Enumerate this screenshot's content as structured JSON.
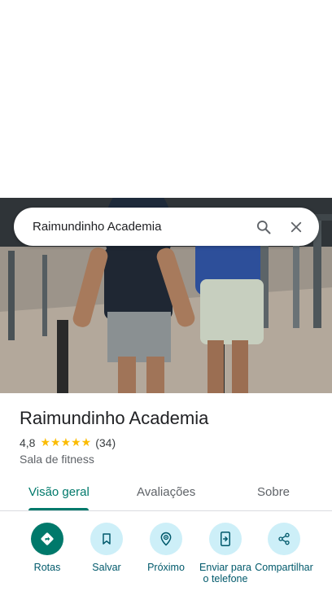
{
  "search": {
    "query": "Raimundinho Academia"
  },
  "place": {
    "name": "Raimundinho Academia",
    "rating": "4,8",
    "stars": "★★★★★",
    "review_count": "(34)",
    "category": "Sala de fitness"
  },
  "tabs": [
    {
      "label": "Visão geral",
      "active": true
    },
    {
      "label": "Avaliações",
      "active": false
    },
    {
      "label": "Sobre",
      "active": false
    }
  ],
  "actions": [
    {
      "label": "Rotas",
      "icon": "directions-icon"
    },
    {
      "label": "Salvar",
      "icon": "bookmark-icon"
    },
    {
      "label": "Próximo",
      "icon": "nearby-icon"
    },
    {
      "label": "Enviar para o telefone",
      "icon": "send-to-phone-icon"
    },
    {
      "label": "Compartilhar",
      "icon": "share-icon"
    }
  ],
  "colors": {
    "accent": "#00796b",
    "action_bg": "#cdeff8",
    "star": "#fbbc04"
  }
}
